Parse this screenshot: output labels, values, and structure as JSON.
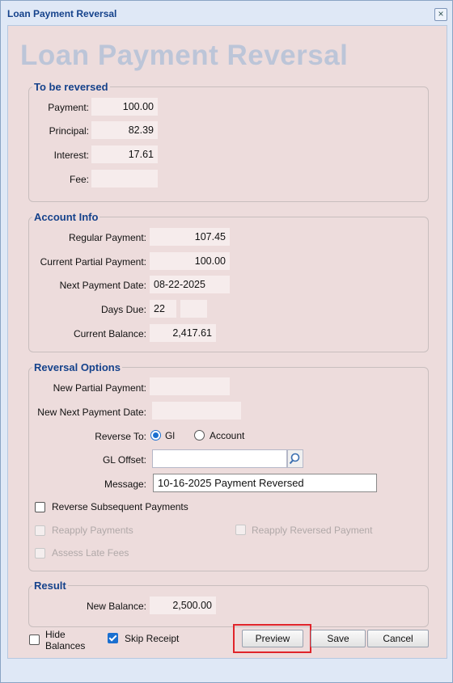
{
  "window": {
    "title": "Loan Payment Reversal",
    "close_icon": "close-icon"
  },
  "page_title": "Loan Payment Reversal",
  "to_be_reversed": {
    "legend": "To be reversed",
    "payment_label": "Payment:",
    "payment": "100.00",
    "principal_label": "Principal:",
    "principal": "82.39",
    "interest_label": "Interest:",
    "interest": "17.61",
    "fee_label": "Fee:",
    "fee": ""
  },
  "account_info": {
    "legend": "Account Info",
    "regular_payment_label": "Regular Payment:",
    "regular_payment": "107.45",
    "current_partial_label": "Current Partial Payment:",
    "current_partial": "100.00",
    "next_payment_date_label": "Next Payment Date:",
    "next_payment_date": "08-22-2025",
    "days_due_label": "Days Due:",
    "days_due": "22",
    "days_due_extra": "",
    "current_balance_label": "Current Balance:",
    "current_balance": "2,417.61"
  },
  "reversal_options": {
    "legend": "Reversal Options",
    "new_partial_label": "New Partial Payment:",
    "new_partial": "",
    "new_next_date_label": "New Next Payment Date:",
    "new_next_date": "",
    "reverse_to_label": "Reverse To:",
    "reverse_to_options": [
      "Gl",
      "Account"
    ],
    "reverse_to_selected": "Gl",
    "gl_offset_label": "GL Offset:",
    "gl_offset": "",
    "message_label": "Message:",
    "message": "10-16-2025 Payment Reversed",
    "reverse_subsequent_label": "Reverse Subsequent Payments",
    "reapply_payments_label": "Reapply Payments",
    "reapply_reversed_label": "Reapply Reversed Payment",
    "assess_late_fees_label": "Assess Late Fees"
  },
  "result": {
    "legend": "Result",
    "new_balance_label": "New Balance:",
    "new_balance": "2,500.00"
  },
  "footer": {
    "hide_balances_label_1": "Hide",
    "hide_balances_label_2": "Balances",
    "skip_receipt_label": "Skip Receipt",
    "preview_label": "Preview",
    "save_label": "Save",
    "cancel_label": "Cancel"
  },
  "colors": {
    "title": "#15428b",
    "highlight": "#e0242a",
    "accent": "#1a6fd0"
  }
}
